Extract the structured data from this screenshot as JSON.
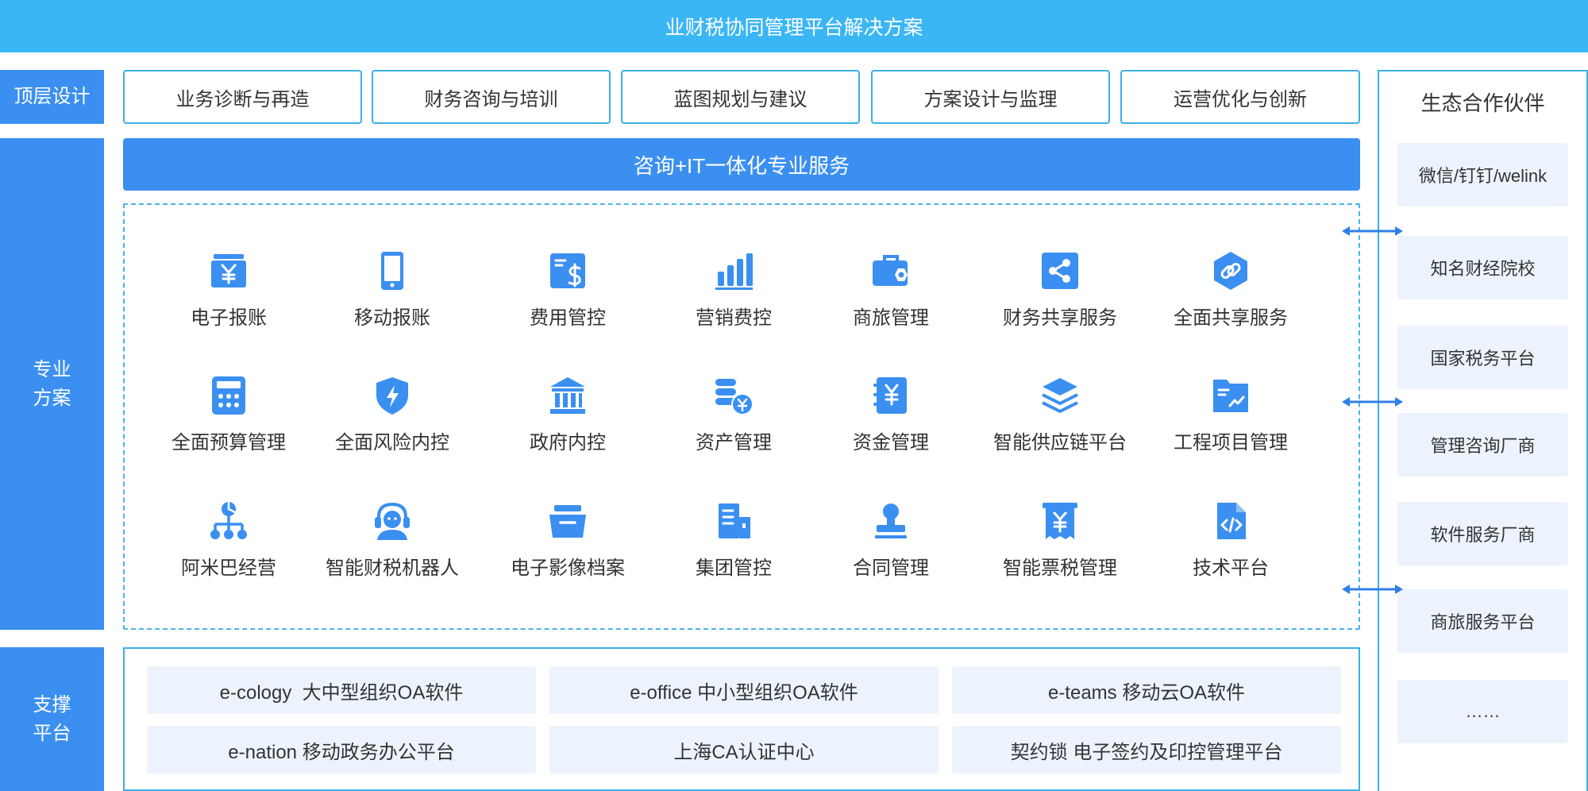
{
  "header": {
    "title": "业财税协同管理平台解决方案"
  },
  "sidebar": {
    "top_design": "顶层设计",
    "solutions": "专业\n方案",
    "support": "支撑\n平台"
  },
  "top_services": [
    "业务诊断与再造",
    "财务咨询与培训",
    "蓝图规划与建议",
    "方案设计与监理",
    "运营优化与创新"
  ],
  "consult_bar": "咨询+IT一体化专业服务",
  "modules": [
    {
      "label": "电子报账",
      "icon": "yen-document-icon"
    },
    {
      "label": "移动报账",
      "icon": "mobile-phone-icon"
    },
    {
      "label": "费用管控",
      "icon": "dollar-card-icon"
    },
    {
      "label": "营销费控",
      "icon": "bar-chart-icon"
    },
    {
      "label": "商旅管理",
      "icon": "briefcase-icon"
    },
    {
      "label": "财务共享服务",
      "icon": "share-icon"
    },
    {
      "label": "全面共享服务",
      "icon": "link-icon"
    },
    {
      "label": "全面预算管理",
      "icon": "calculator-icon"
    },
    {
      "label": "全面风险内控",
      "icon": "shield-bolt-icon"
    },
    {
      "label": "政府内控",
      "icon": "government-building-icon"
    },
    {
      "label": "资产管理",
      "icon": "coin-stack-icon"
    },
    {
      "label": "资金管理",
      "icon": "yen-notebook-icon"
    },
    {
      "label": "智能供应链平台",
      "icon": "layers-icon"
    },
    {
      "label": "工程项目管理",
      "icon": "project-folder-icon"
    },
    {
      "label": "阿米巴经营",
      "icon": "org-tree-icon"
    },
    {
      "label": "智能财税机器人",
      "icon": "headset-agent-icon"
    },
    {
      "label": "电子影像档案",
      "icon": "archive-box-icon"
    },
    {
      "label": "集团管控",
      "icon": "office-building-icon"
    },
    {
      "label": "合同管理",
      "icon": "stamp-icon"
    },
    {
      "label": "智能票税管理",
      "icon": "yen-receipt-icon"
    },
    {
      "label": "技术平台",
      "icon": "code-file-icon"
    }
  ],
  "support_platforms": [
    "e-cology  大中型组织OA软件",
    "e-office 中小型组织OA软件",
    "e-teams 移动云OA软件",
    "e-nation 移动政务办公平台",
    "上海CA认证中心",
    "契约锁 电子签约及印控管理平台"
  ],
  "partners": {
    "title": "生态合作伙伴",
    "items": [
      "微信/钉钉/welink",
      "知名财经院校",
      "国家税务平台",
      "管理咨询厂商",
      "软件服务厂商",
      "商旅服务平台",
      "……"
    ]
  },
  "colors": {
    "banner": "#3bb6f5",
    "primary": "#3b8ff0",
    "border": "#3bb0e8",
    "light_fill": "#ecf3fc"
  }
}
